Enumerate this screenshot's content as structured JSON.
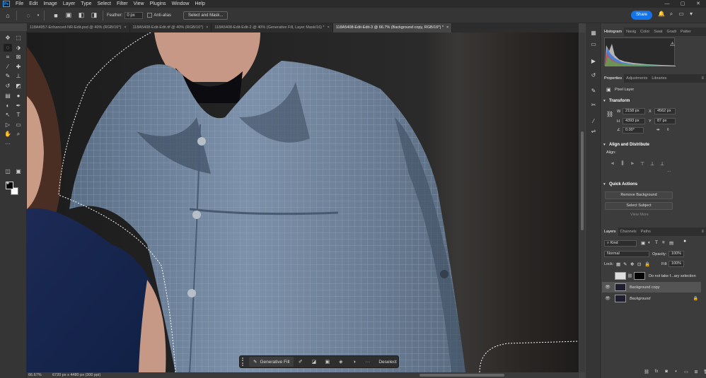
{
  "app": {
    "logo": "Ps"
  },
  "menu": [
    "File",
    "Edit",
    "Image",
    "Layer",
    "Type",
    "Select",
    "Filter",
    "View",
    "Plugins",
    "Window",
    "Help"
  ],
  "window_controls": [
    "—",
    "▢",
    "✕"
  ],
  "options": {
    "feather_label": "Feather:",
    "feather_value": "0 px",
    "antialias_label": "Anti-alias",
    "select_mask_label": "Select and Mask...",
    "share_label": "Share"
  },
  "tabs": [
    {
      "label": "118A4957-Enhanced-NR-Edit.psd @ 40% (RGB/16*)",
      "close": "×"
    },
    {
      "label": "118A5408-Edit-Edit.tif @ 40% (RGB/16*)",
      "close": "×"
    },
    {
      "label": "118A5408-Edit-Edit-2 @ 40% (Generative Fill, Layer Mask/16) *",
      "close": "×"
    },
    {
      "label": "118A5408-Edit-Edit-3 @ 66.7% (Background copy, RGB/16*) *",
      "close": "×"
    }
  ],
  "status": {
    "zoom": "66.67%",
    "doc_info": "6720 px x 4480 px (300 ppi)"
  },
  "taskbar": {
    "generative_fill": "Generative Fill",
    "deselect": "Deselect",
    "more": "···"
  },
  "panels": {
    "histogram_tabs": [
      "Histogram",
      "Navig",
      "Color",
      "Swat",
      "Gradi",
      "Patter"
    ],
    "properties_tabs": [
      "Properties",
      "Adjustments",
      "Libraries"
    ],
    "pixel_layer": "Pixel Layer",
    "transform": {
      "title": "Transform",
      "w_label": "W",
      "w_value": "2158 px",
      "h_label": "H",
      "h_value": "4393 px",
      "x_label": "X",
      "x_value": "4562 px",
      "y_label": "Y",
      "y_value": "87 px",
      "angle_value": "0.00°"
    },
    "align": {
      "title": "Align and Distribute",
      "align_label": "Align:",
      "more": "···"
    },
    "quick_actions": {
      "title": "Quick Actions",
      "remove_bg": "Remove Background",
      "select_subject": "Select Subject",
      "view_more": "View More"
    }
  },
  "layers": {
    "tabs": [
      "Layers",
      "Channels",
      "Paths"
    ],
    "kind_label": "Kind",
    "blend_mode": "Normal",
    "opacity_label": "Opacity:",
    "opacity_value": "100%",
    "lock_label": "Lock:",
    "fill_label": "Fill:",
    "fill_value": "100%",
    "items": [
      {
        "name": "Do not take f...ary selection",
        "visible": false
      },
      {
        "name": "Background copy",
        "visible": true
      },
      {
        "name": "Background",
        "visible": true
      }
    ]
  }
}
